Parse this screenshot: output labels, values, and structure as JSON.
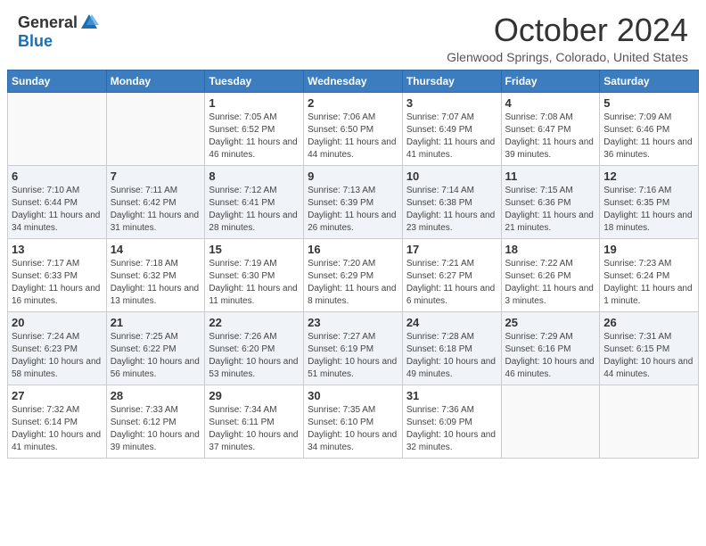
{
  "header": {
    "logo_general": "General",
    "logo_blue": "Blue",
    "month_title": "October 2024",
    "location": "Glenwood Springs, Colorado, United States"
  },
  "days_of_week": [
    "Sunday",
    "Monday",
    "Tuesday",
    "Wednesday",
    "Thursday",
    "Friday",
    "Saturday"
  ],
  "weeks": [
    [
      {
        "day": "",
        "info": ""
      },
      {
        "day": "",
        "info": ""
      },
      {
        "day": "1",
        "info": "Sunrise: 7:05 AM\nSunset: 6:52 PM\nDaylight: 11 hours and 46 minutes."
      },
      {
        "day": "2",
        "info": "Sunrise: 7:06 AM\nSunset: 6:50 PM\nDaylight: 11 hours and 44 minutes."
      },
      {
        "day": "3",
        "info": "Sunrise: 7:07 AM\nSunset: 6:49 PM\nDaylight: 11 hours and 41 minutes."
      },
      {
        "day": "4",
        "info": "Sunrise: 7:08 AM\nSunset: 6:47 PM\nDaylight: 11 hours and 39 minutes."
      },
      {
        "day": "5",
        "info": "Sunrise: 7:09 AM\nSunset: 6:46 PM\nDaylight: 11 hours and 36 minutes."
      }
    ],
    [
      {
        "day": "6",
        "info": "Sunrise: 7:10 AM\nSunset: 6:44 PM\nDaylight: 11 hours and 34 minutes."
      },
      {
        "day": "7",
        "info": "Sunrise: 7:11 AM\nSunset: 6:42 PM\nDaylight: 11 hours and 31 minutes."
      },
      {
        "day": "8",
        "info": "Sunrise: 7:12 AM\nSunset: 6:41 PM\nDaylight: 11 hours and 28 minutes."
      },
      {
        "day": "9",
        "info": "Sunrise: 7:13 AM\nSunset: 6:39 PM\nDaylight: 11 hours and 26 minutes."
      },
      {
        "day": "10",
        "info": "Sunrise: 7:14 AM\nSunset: 6:38 PM\nDaylight: 11 hours and 23 minutes."
      },
      {
        "day": "11",
        "info": "Sunrise: 7:15 AM\nSunset: 6:36 PM\nDaylight: 11 hours and 21 minutes."
      },
      {
        "day": "12",
        "info": "Sunrise: 7:16 AM\nSunset: 6:35 PM\nDaylight: 11 hours and 18 minutes."
      }
    ],
    [
      {
        "day": "13",
        "info": "Sunrise: 7:17 AM\nSunset: 6:33 PM\nDaylight: 11 hours and 16 minutes."
      },
      {
        "day": "14",
        "info": "Sunrise: 7:18 AM\nSunset: 6:32 PM\nDaylight: 11 hours and 13 minutes."
      },
      {
        "day": "15",
        "info": "Sunrise: 7:19 AM\nSunset: 6:30 PM\nDaylight: 11 hours and 11 minutes."
      },
      {
        "day": "16",
        "info": "Sunrise: 7:20 AM\nSunset: 6:29 PM\nDaylight: 11 hours and 8 minutes."
      },
      {
        "day": "17",
        "info": "Sunrise: 7:21 AM\nSunset: 6:27 PM\nDaylight: 11 hours and 6 minutes."
      },
      {
        "day": "18",
        "info": "Sunrise: 7:22 AM\nSunset: 6:26 PM\nDaylight: 11 hours and 3 minutes."
      },
      {
        "day": "19",
        "info": "Sunrise: 7:23 AM\nSunset: 6:24 PM\nDaylight: 11 hours and 1 minute."
      }
    ],
    [
      {
        "day": "20",
        "info": "Sunrise: 7:24 AM\nSunset: 6:23 PM\nDaylight: 10 hours and 58 minutes."
      },
      {
        "day": "21",
        "info": "Sunrise: 7:25 AM\nSunset: 6:22 PM\nDaylight: 10 hours and 56 minutes."
      },
      {
        "day": "22",
        "info": "Sunrise: 7:26 AM\nSunset: 6:20 PM\nDaylight: 10 hours and 53 minutes."
      },
      {
        "day": "23",
        "info": "Sunrise: 7:27 AM\nSunset: 6:19 PM\nDaylight: 10 hours and 51 minutes."
      },
      {
        "day": "24",
        "info": "Sunrise: 7:28 AM\nSunset: 6:18 PM\nDaylight: 10 hours and 49 minutes."
      },
      {
        "day": "25",
        "info": "Sunrise: 7:29 AM\nSunset: 6:16 PM\nDaylight: 10 hours and 46 minutes."
      },
      {
        "day": "26",
        "info": "Sunrise: 7:31 AM\nSunset: 6:15 PM\nDaylight: 10 hours and 44 minutes."
      }
    ],
    [
      {
        "day": "27",
        "info": "Sunrise: 7:32 AM\nSunset: 6:14 PM\nDaylight: 10 hours and 41 minutes."
      },
      {
        "day": "28",
        "info": "Sunrise: 7:33 AM\nSunset: 6:12 PM\nDaylight: 10 hours and 39 minutes."
      },
      {
        "day": "29",
        "info": "Sunrise: 7:34 AM\nSunset: 6:11 PM\nDaylight: 10 hours and 37 minutes."
      },
      {
        "day": "30",
        "info": "Sunrise: 7:35 AM\nSunset: 6:10 PM\nDaylight: 10 hours and 34 minutes."
      },
      {
        "day": "31",
        "info": "Sunrise: 7:36 AM\nSunset: 6:09 PM\nDaylight: 10 hours and 32 minutes."
      },
      {
        "day": "",
        "info": ""
      },
      {
        "day": "",
        "info": ""
      }
    ]
  ]
}
